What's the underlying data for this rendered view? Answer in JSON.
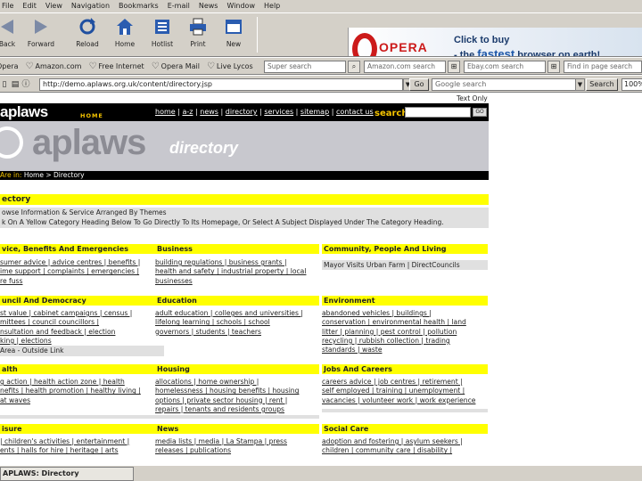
{
  "menu": [
    "File",
    "Edit",
    "View",
    "Navigation",
    "Bookmarks",
    "E-mail",
    "News",
    "Window",
    "Help"
  ],
  "toolbar": {
    "buttons": [
      {
        "label": "Back"
      },
      {
        "label": "Forward"
      },
      {
        "label": "Reload"
      },
      {
        "label": "Home"
      },
      {
        "label": "Hotlist"
      },
      {
        "label": "Print"
      },
      {
        "label": "New"
      }
    ]
  },
  "ad": {
    "brand": "OPERA",
    "line1": "Click to buy",
    "line2_prefix": "- the",
    "line2_emph": "fastest",
    "line2_suffix": "browser on earth!"
  },
  "personal_bar": {
    "items": [
      "Opera",
      "Amazon.com",
      "Free Internet",
      "Opera Mail",
      "Live Lycos"
    ],
    "searches": [
      "Super search",
      "Amazon.com search",
      "Ebay.com search",
      "Find in page search"
    ]
  },
  "address": {
    "url": "http://demo.aplaws.org.uk/content/directory.jsp",
    "go_label": "Go",
    "search_placeholder": "Google search",
    "search_button": "Search",
    "zoom": "100%"
  },
  "site": {
    "text_only": "Text Only",
    "logo": "aplaws",
    "home_tag": "HOME",
    "nav": [
      "home",
      "a-z",
      "news",
      "directory",
      "services",
      "sitemap",
      "contact us"
    ],
    "search_label": "search",
    "go_small": "GO",
    "banner_word": "aplaws",
    "banner_sub": "directory",
    "breadcrumb_you": "Are in:",
    "breadcrumb": "Home > Directory",
    "dir_title": "ectory",
    "dir_desc1": "owse Information & Service Arranged By Themes",
    "dir_desc2": "k On A Yellow Category Heading Below To Go Directly To Its Homepage, Or Select A Subject Displayed Under The Category Heading."
  },
  "categories": [
    {
      "title": "vice, Benefits And Emergencies",
      "lines": [
        "sumer advice | advice centres | benefits |",
        "ime support | complaints | emergencies |",
        "re fuss"
      ]
    },
    {
      "title": "Business",
      "lines": [
        "building regulations | business grants |",
        "health and safety | industrial property | local",
        "businesses"
      ]
    },
    {
      "title": "Community, People And Living",
      "lines": [
        "Mayor Visits Urban Farm | DirectCouncils"
      ]
    },
    {
      "title": "uncil And Democracy",
      "lines": [
        "st value | cabinet campaigns | census |",
        "mittees | council councillors |",
        "nsultation and feedback | election",
        "king | elections",
        "Area - Outside Link"
      ]
    },
    {
      "title": "Education",
      "lines": [
        "adult education | colleges and universities |",
        "lifelong learning | schools | school",
        "governors | students | teachers"
      ]
    },
    {
      "title": "Environment",
      "lines": [
        "abandoned vehicles | buildings |",
        "conservation | environmental health | land",
        "litter | planning | pest control | pollution",
        "recycling | rubbish collection | trading",
        "standards | waste"
      ]
    },
    {
      "title": "alth",
      "lines": [
        "g action | health action zone | health",
        "nefits | health promotion | healthy living |",
        "at waves"
      ]
    },
    {
      "title": "Housing",
      "lines": [
        "allocations | home ownership |",
        "homelessness | housing benefits | housing",
        "options | private sector housing | rent |",
        "repairs | tenants and residents groups"
      ]
    },
    {
      "title": "Jobs And Careers",
      "lines": [
        "careers advice | job centres | retirement |",
        "self employed | training | unemployment |",
        "vacancies | volunteer work | work experience"
      ]
    },
    {
      "title": "isure",
      "lines": [
        "| children's activities | entertainment |",
        "ents | halls for hire | heritage | arts"
      ]
    },
    {
      "title": "News",
      "lines": [
        "media lists | media | La Stampa | press",
        "releases | publications"
      ]
    },
    {
      "title": "Social Care",
      "lines": [
        "adoption and fostering | asylum seekers |",
        "children | community care | disability |"
      ]
    }
  ],
  "status": {
    "tab_title": "APLAWS: Directory"
  }
}
